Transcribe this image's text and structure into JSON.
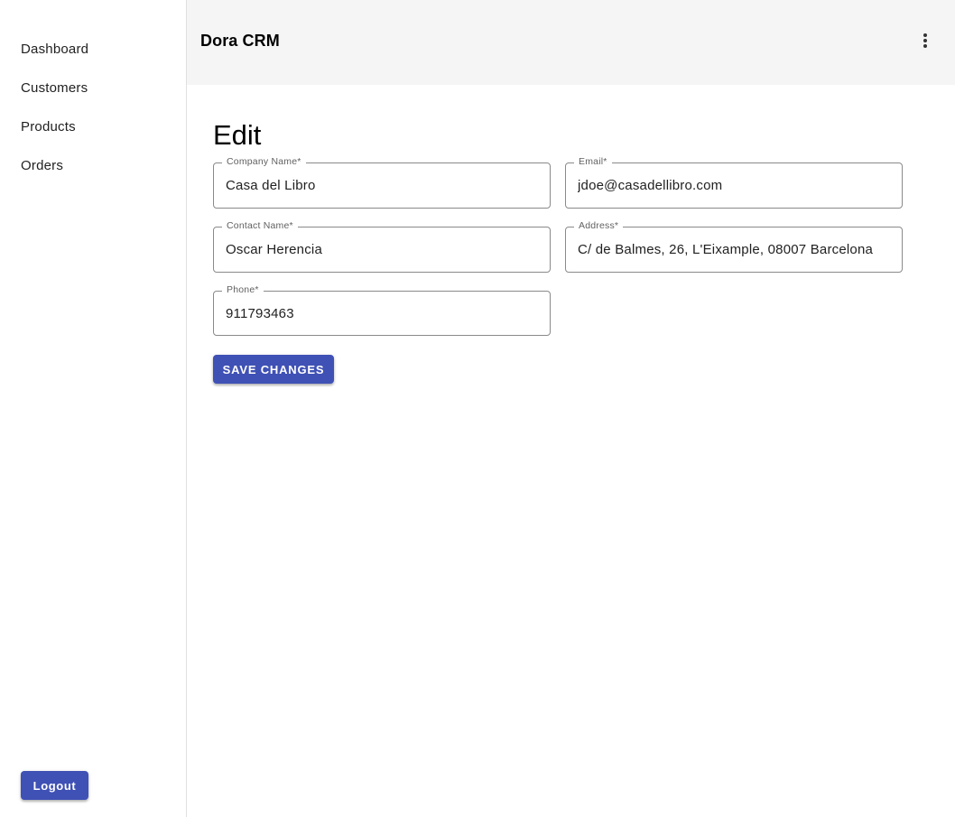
{
  "header": {
    "app_title": "Dora CRM",
    "menu_icon": "more-vertical-icon"
  },
  "sidebar": {
    "items": [
      {
        "label": "Dashboard"
      },
      {
        "label": "Customers"
      },
      {
        "label": "Products"
      },
      {
        "label": "Orders"
      }
    ],
    "logout_label": "Logout"
  },
  "form": {
    "title": "Edit",
    "fields": {
      "company_name": {
        "label": "Company Name*",
        "value": "Casa del Libro"
      },
      "email": {
        "label": "Email*",
        "value": "jdoe@casadellibro.com"
      },
      "contact_name": {
        "label": "Contact Name*",
        "value": "Oscar Herencia"
      },
      "address": {
        "label": "Address*",
        "value": "C/ de Balmes, 26, L'Eixample, 08007 Barcelona"
      },
      "phone": {
        "label": "Phone*",
        "value": "911793463"
      }
    },
    "save_label": "SAVE CHANGES"
  },
  "colors": {
    "primary": "#3f51b5",
    "header_bg": "#f5f5f5"
  }
}
